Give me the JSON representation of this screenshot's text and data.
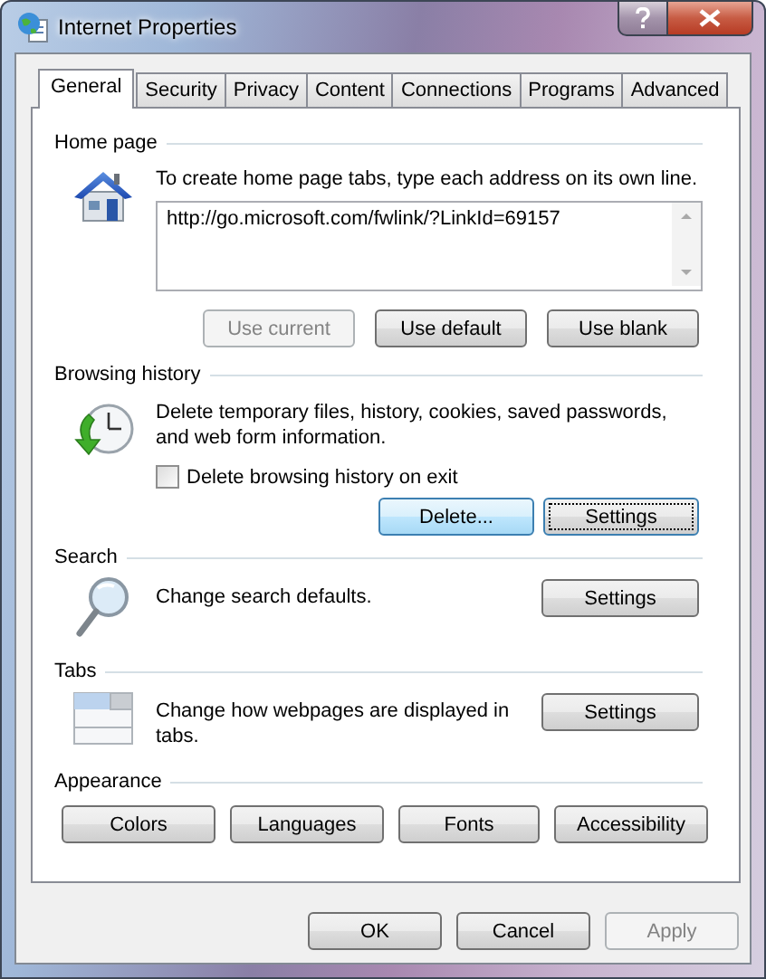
{
  "window": {
    "title": "Internet Properties"
  },
  "tabs": [
    {
      "label": "General",
      "selected": true
    },
    {
      "label": "Security",
      "selected": false
    },
    {
      "label": "Privacy",
      "selected": false
    },
    {
      "label": "Content",
      "selected": false
    },
    {
      "label": "Connections",
      "selected": false
    },
    {
      "label": "Programs",
      "selected": false
    },
    {
      "label": "Advanced",
      "selected": false
    }
  ],
  "sections": [
    {
      "kind": "home",
      "title": "Home page",
      "description": "To create home page tabs, type each address on its own line.",
      "address": "http://go.microsoft.com/fwlink/?LinkId=69157",
      "buttons": [
        {
          "label": "Use current",
          "disabled": true
        },
        {
          "label": "Use default",
          "disabled": false
        },
        {
          "label": "Use blank",
          "disabled": false
        }
      ]
    },
    {
      "kind": "history",
      "title": "Browsing history",
      "description": "Delete temporary files, history, cookies, saved passwords, and web form information.",
      "checkbox": {
        "label": "Delete browsing history on exit",
        "checked": false
      },
      "buttons": [
        {
          "label": "Delete...",
          "disabled": false,
          "highlighted": true,
          "focused": false
        },
        {
          "label": "Settings",
          "disabled": false,
          "highlighted": false,
          "focused": true
        }
      ]
    },
    {
      "kind": "search",
      "title": "Search",
      "description": "Change search defaults.",
      "buttons": [
        {
          "label": "Settings",
          "disabled": false
        }
      ]
    },
    {
      "kind": "tabs",
      "title": "Tabs",
      "description": "Change how webpages are displayed in tabs.",
      "buttons": [
        {
          "label": "Settings",
          "disabled": false
        }
      ]
    },
    {
      "kind": "appearance",
      "title": "Appearance",
      "buttons": [
        {
          "label": "Colors",
          "disabled": false
        },
        {
          "label": "Languages",
          "disabled": false
        },
        {
          "label": "Fonts",
          "disabled": false
        },
        {
          "label": "Accessibility",
          "disabled": false
        }
      ]
    }
  ],
  "footer_buttons": [
    {
      "label": "OK",
      "disabled": false
    },
    {
      "label": "Cancel",
      "disabled": false
    },
    {
      "label": "Apply",
      "disabled": true
    }
  ]
}
